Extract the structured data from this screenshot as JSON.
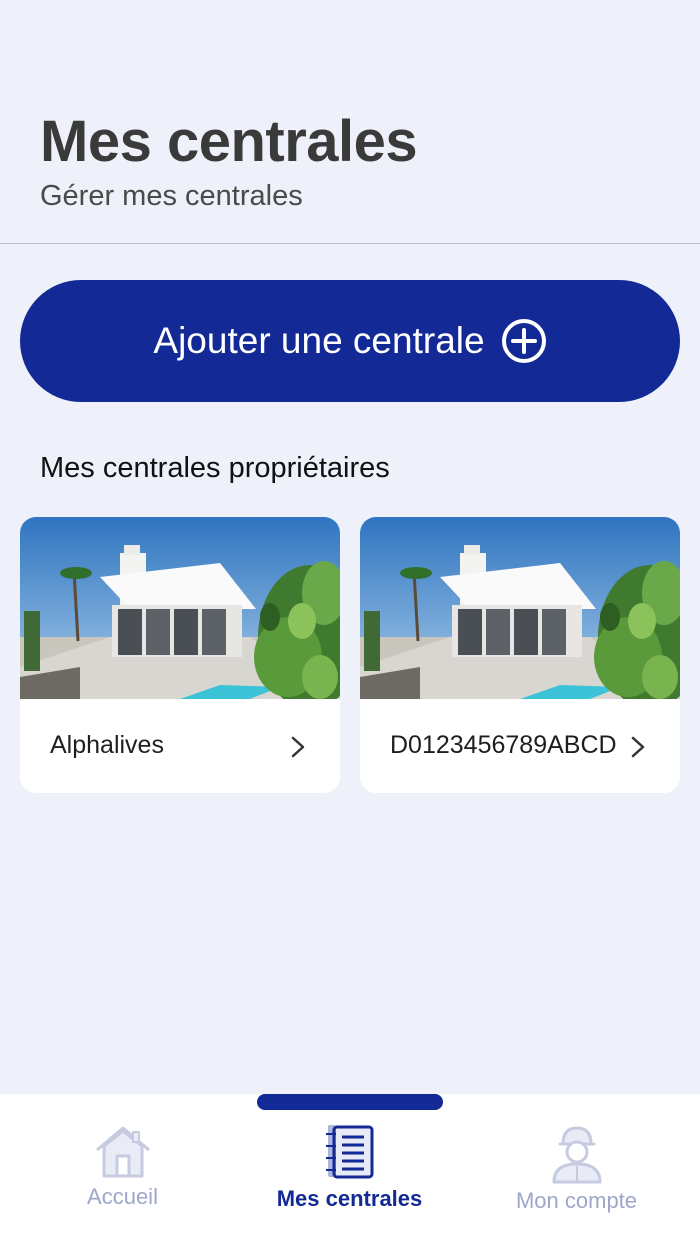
{
  "header": {
    "title": "Mes centrales",
    "subtitle": "Gérer mes centrales"
  },
  "add_button": {
    "label": "Ajouter une centrale",
    "icon": "plus-circle-icon"
  },
  "section": {
    "title": "Mes centrales propriétaires"
  },
  "cards": [
    {
      "name": "Alphalives",
      "image": "house-photo",
      "icon": "chevron-right-icon"
    },
    {
      "name": "D0123456789ABCD",
      "image": "house-photo",
      "icon": "chevron-right-icon"
    }
  ],
  "bottom_nav": {
    "items": [
      {
        "label": "Accueil",
        "icon": "home-icon",
        "active": false
      },
      {
        "label": "Mes centrales",
        "icon": "notebook-icon",
        "active": true
      },
      {
        "label": "Mon compte",
        "icon": "user-icon",
        "active": false
      }
    ]
  },
  "colors": {
    "primary": "#132a96",
    "background": "#eef1f9",
    "inactive_nav": "#9fa6c9"
  }
}
